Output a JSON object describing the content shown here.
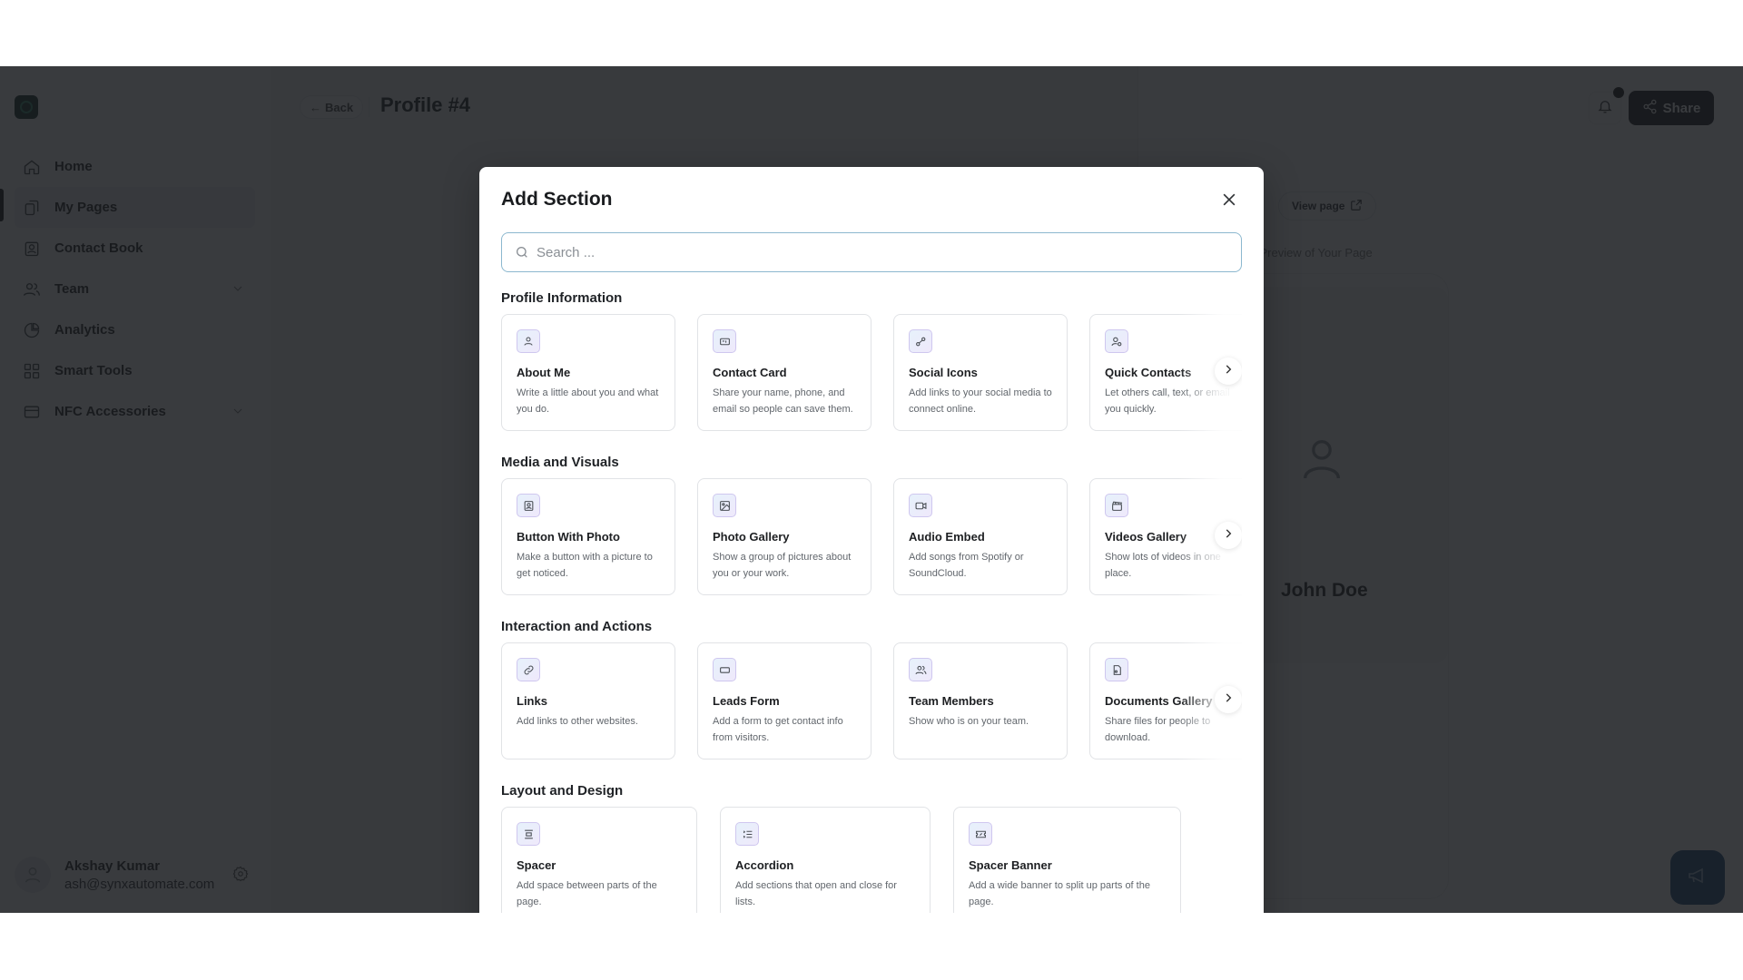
{
  "sidebar": {
    "items": [
      {
        "label": "Home",
        "icon": "home-icon"
      },
      {
        "label": "My Pages",
        "icon": "pages-icon",
        "active": true
      },
      {
        "label": "Contact Book",
        "icon": "contact-book-icon"
      },
      {
        "label": "Team",
        "icon": "team-icon",
        "expandable": true
      },
      {
        "label": "Analytics",
        "icon": "pie-chart-icon"
      },
      {
        "label": "Smart Tools",
        "icon": "grid-icon"
      },
      {
        "label": "NFC Accessories",
        "icon": "card-icon",
        "expandable": true
      }
    ],
    "user": {
      "name": "Akshay Kumar",
      "email": "ash@synxautomate.com"
    }
  },
  "header": {
    "back_label": "Back",
    "title": "Profile #4",
    "share_label": "Share"
  },
  "preview": {
    "view_page_label": "View page",
    "label": "Live Preview of Your Page",
    "name": "John Doe"
  },
  "modal": {
    "title": "Add Section",
    "search_placeholder": "Search ...",
    "groups": [
      {
        "title": "Profile Information",
        "cards": [
          {
            "title": "About Me",
            "desc": "Write a little about you and what you do.",
            "icon": "user-icon"
          },
          {
            "title": "Contact Card",
            "desc": "Share your name, phone, and email so people can save them.",
            "icon": "id-card-icon"
          },
          {
            "title": "Social Icons",
            "desc": "Add links to your social media to connect online.",
            "icon": "social-icon"
          },
          {
            "title": "Quick Contacts",
            "desc": "Let others call, text, or email you quickly.",
            "icon": "user-search-icon"
          }
        ]
      },
      {
        "title": "Media and Visuals",
        "cards": [
          {
            "title": "Button With Photo",
            "desc": "Make a button with a picture to get noticed.",
            "icon": "photo-button-icon"
          },
          {
            "title": "Photo Gallery",
            "desc": "Show a group of pictures about you or your work.",
            "icon": "image-icon"
          },
          {
            "title": "Audio Embed",
            "desc": "Add songs from Spotify or SoundCloud.",
            "icon": "video-camera-icon"
          },
          {
            "title": "Videos Gallery",
            "desc": "Show lots of videos in one place.",
            "icon": "clapperboard-icon"
          }
        ]
      },
      {
        "title": "Interaction and Actions",
        "cards": [
          {
            "title": "Links",
            "desc": "Add links to other websites.",
            "icon": "link-icon"
          },
          {
            "title": "Leads Form",
            "desc": "Add a form to get contact info from visitors.",
            "icon": "form-icon"
          },
          {
            "title": "Team Members",
            "desc": "Show who is on your team.",
            "icon": "team-icon"
          },
          {
            "title": "Documents Gallery",
            "desc": "Share files for people to download.",
            "icon": "document-icon"
          }
        ]
      },
      {
        "title": "Layout and Design",
        "cards": [
          {
            "title": "Spacer",
            "desc": "Add space between parts of the page.",
            "icon": "spacer-icon"
          },
          {
            "title": "Accordion",
            "desc": "Add sections that open and close for lists.",
            "icon": "list-icon"
          },
          {
            "title": "Spacer Banner",
            "desc": "Add a wide banner to split up parts of the page.",
            "icon": "ticket-icon"
          }
        ]
      }
    ]
  }
}
